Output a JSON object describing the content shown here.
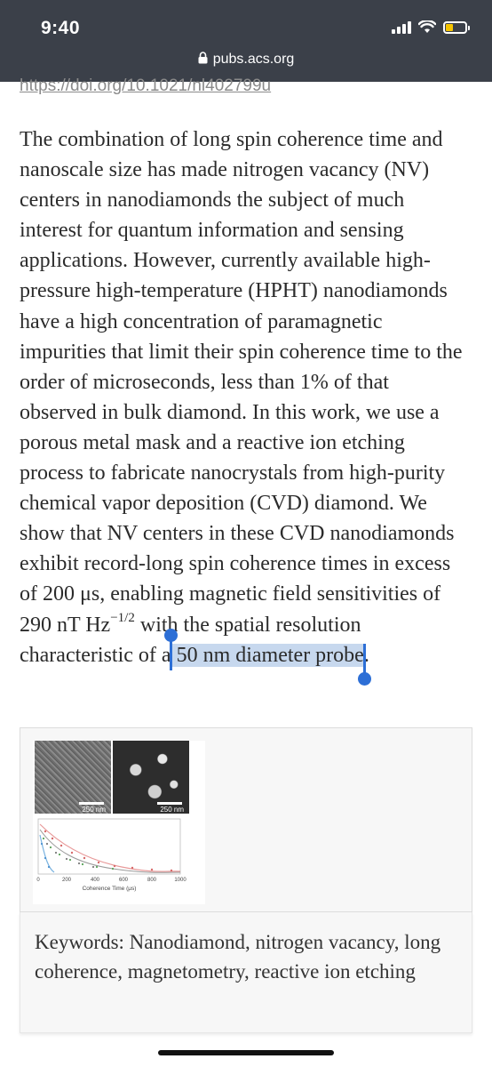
{
  "status": {
    "time": "9:40"
  },
  "browser": {
    "domain": "pubs.acs.org"
  },
  "doi_link": "https://doi.org/10.1021/nl402799u",
  "abstract": {
    "text_before_sup": "The combination of long spin coherence time and nanoscale size has made nitrogen vacancy (NV) centers in nanodiamonds the subject of much interest for quantum information and sensing applications. However, currently available high-pressure high-temperature (HPHT) nanodiamonds have a high concentration of paramagnetic impurities that limit their spin coherence time to the order of microseconds, less than 1% of that observed in bulk diamond. In this work, we use a porous metal mask and a reactive ion etching process to fabricate nanocrystals from high-purity chemical vapor deposition (CVD) diamond. We show that NV centers in these CVD nanodiamonds exhibit record-long spin coherence times in excess of 200 μs, enabling magnetic field sensitivities of 290 nT Hz",
    "sup": "−1/2",
    "text_after_sup": " with the spatial resolution characteristic of a",
    "selected_text": " 50 nm diameter probe",
    "text_end": "."
  },
  "toc_figure": {
    "panel_labels": [
      "250 nm",
      "250 nm"
    ],
    "xlabel": "Coherence Time (μs)",
    "xticks": [
      "0",
      "200",
      "400",
      "600",
      "800",
      "1000"
    ]
  },
  "keywords": "Keywords: Nanodiamond, nitrogen vacancy, long coherence, magnetometry, reactive ion etching",
  "colors": {
    "topbar": "#3b4049",
    "selection": "#c7d8ee",
    "handle": "#2d6fd6",
    "battery": "#f5c400"
  }
}
